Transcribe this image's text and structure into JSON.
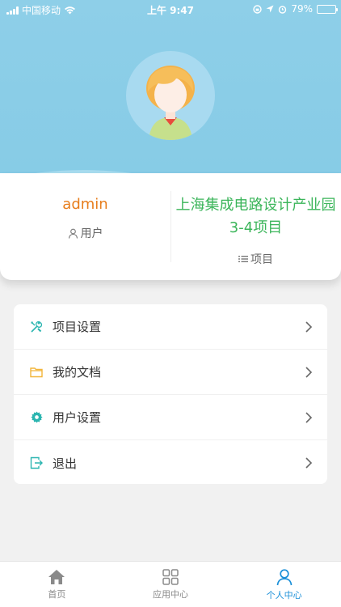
{
  "status_bar": {
    "carrier": "中国移动",
    "time": "上午 9:47",
    "battery_percent": "79%",
    "battery_level": 0.79
  },
  "profile": {
    "username": "admin",
    "role_label": "用户",
    "project_name": "上海集成电路设计产业园3-4项目",
    "project_label": "项目"
  },
  "menu": {
    "items": [
      {
        "label": "项目设置",
        "icon": "tools-icon",
        "color": "#2bb5b0"
      },
      {
        "label": "我的文档",
        "icon": "folder-icon",
        "color": "#f2b53a"
      },
      {
        "label": "用户设置",
        "icon": "gear-icon",
        "color": "#2bb5b0"
      },
      {
        "label": "退出",
        "icon": "logout-icon",
        "color": "#2bb5b0"
      }
    ]
  },
  "tabbar": {
    "tabs": [
      {
        "label": "首页",
        "icon": "home-icon",
        "active": false
      },
      {
        "label": "应用中心",
        "icon": "grid-icon",
        "active": false
      },
      {
        "label": "个人中心",
        "icon": "person-icon",
        "active": true
      }
    ]
  },
  "colors": {
    "header": "#8ecfe8",
    "username": "#e77d1c",
    "project": "#3bb55a",
    "active_tab": "#1a8fd8"
  }
}
